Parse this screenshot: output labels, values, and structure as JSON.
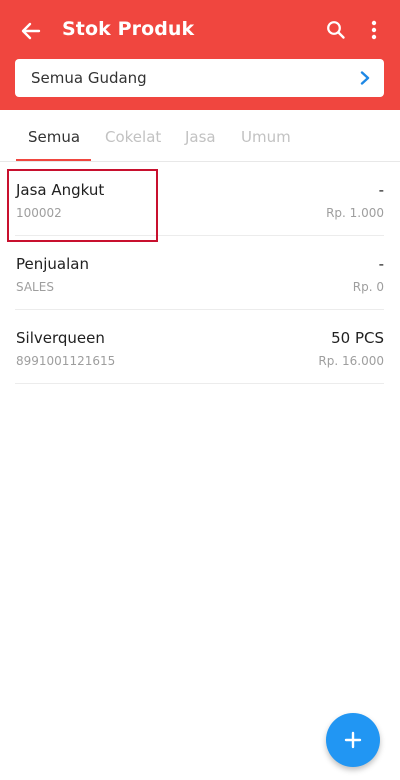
{
  "appbar": {
    "title": "Stok Produk",
    "color": "#f0463f",
    "icons": [
      "arrow-back-icon",
      "search-icon",
      "more-vert-icon"
    ]
  },
  "warehouse_selector": {
    "label": "Semua Gudang",
    "chevron_color": "#1e88e5"
  },
  "tabs": [
    {
      "label": "Semua",
      "active": true
    },
    {
      "label": "Cokelat",
      "active": false
    },
    {
      "label": "Jasa",
      "active": false
    },
    {
      "label": "Umum",
      "active": false
    }
  ],
  "products": [
    {
      "name": "Jasa Angkut",
      "code": "100002",
      "qty": "-",
      "price": "Rp. 1.000"
    },
    {
      "name": "Penjualan",
      "code": "SALES",
      "qty": "-",
      "price": "Rp. 0"
    },
    {
      "name": "Silverqueen",
      "code": "8991001121615",
      "qty": "50 PCS",
      "price": "Rp. 16.000"
    }
  ],
  "fab": {
    "icon": "add-icon",
    "color": "#2196f3"
  },
  "highlight_color": "#c8102e"
}
